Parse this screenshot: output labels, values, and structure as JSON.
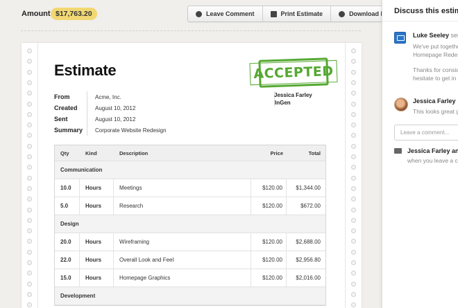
{
  "header": {
    "amount_label": "Amount",
    "amount_value": "$17,763.20",
    "toolbar": [
      {
        "label": "Leave Comment",
        "icon": "comment-icon"
      },
      {
        "label": "Print Estimate",
        "icon": "printer-icon"
      },
      {
        "label": "Download PDF",
        "icon": "download-icon"
      }
    ]
  },
  "document": {
    "title": "Estimate",
    "stamp": "ACCEPTED",
    "stamp_color": "#55a832",
    "meta": [
      {
        "key": "From",
        "value": "Acme, Inc."
      },
      {
        "key": "Created",
        "value": "August 10, 2012"
      },
      {
        "key": "Sent",
        "value": "August 10, 2012"
      },
      {
        "key": "Summary",
        "value": "Corporate Website Redesign"
      }
    ],
    "client": {
      "name": "Jessica Farley",
      "company": "InGen"
    },
    "table": {
      "headers": {
        "qty": "Qty",
        "kind": "Kind",
        "description": "Description",
        "price": "Price",
        "total": "Total"
      },
      "groups": [
        {
          "name": "Communication",
          "items": [
            {
              "qty": "10.0",
              "kind": "Hours",
              "description": "Meetings",
              "price": "$120.00",
              "total": "$1,344.00"
            },
            {
              "qty": "5.0",
              "kind": "Hours",
              "description": "Research",
              "price": "$120.00",
              "total": "$672.00"
            }
          ]
        },
        {
          "name": "Design",
          "items": [
            {
              "qty": "20.0",
              "kind": "Hours",
              "description": "Wireframing",
              "price": "$120.00",
              "total": "$2,688.00"
            },
            {
              "qty": "22.0",
              "kind": "Hours",
              "description": "Overall Look and Feel",
              "price": "$120.00",
              "total": "$2,956.80"
            },
            {
              "qty": "15.0",
              "kind": "Hours",
              "description": "Homepage Graphics",
              "price": "$120.00",
              "total": "$2,016.00"
            }
          ]
        },
        {
          "name": "Development",
          "items": []
        }
      ]
    }
  },
  "sidebar": {
    "title": "Discuss this estimate",
    "messages": [
      {
        "author": "Luke Seeley",
        "verb": "sent",
        "lines": [
          "We've put together",
          "Homepage Redes",
          "Thanks for consid",
          "hesitate to get in"
        ]
      },
      {
        "author": "Jessica Farley",
        "lines": [
          "This looks great g"
        ]
      }
    ],
    "comment_placeholder": "Leave a comment...",
    "notify": {
      "names": "Jessica Farley and m",
      "text": "when you leave a co"
    }
  }
}
